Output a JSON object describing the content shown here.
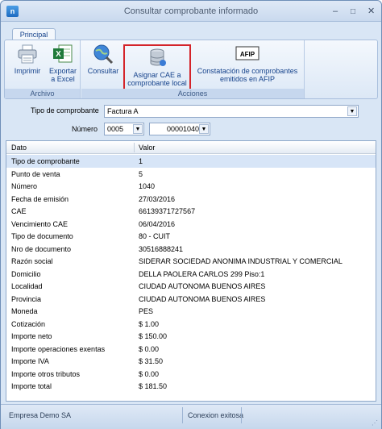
{
  "window": {
    "title": "Consultar comprobante informado",
    "app_icon": "n",
    "min_glyph": "–",
    "max_glyph": "□",
    "close_glyph": "✕"
  },
  "ribbon": {
    "tab_label": "Principal",
    "groups": {
      "archivo": "Archivo",
      "acciones": "Acciones"
    },
    "buttons": {
      "imprimir": "Imprimir",
      "exportar": "Exportar\na Excel",
      "consultar": "Consultar",
      "asignar": "Asignar CAE a\ncomprobante local",
      "constatacion": "Constatación de comprobantes\nemitidos en AFIP"
    },
    "afip_logo_text": "AFIP",
    "highlight_color": "#d4242a"
  },
  "form": {
    "tipo_label": "Tipo de comprobante",
    "tipo_value": "Factura A",
    "numero_label": "Número",
    "punto_venta_value": "0005",
    "numero_value": "00001040",
    "dropdown_glyph": "▼"
  },
  "grid": {
    "col_dato": "Dato",
    "col_valor": "Valor",
    "rows": [
      {
        "dato": "Tipo de comprobante",
        "valor": "1"
      },
      {
        "dato": "Punto de venta",
        "valor": "5"
      },
      {
        "dato": "Número",
        "valor": "1040"
      },
      {
        "dato": "Fecha de emisión",
        "valor": "27/03/2016"
      },
      {
        "dato": "CAE",
        "valor": "66139371727567"
      },
      {
        "dato": "Vencimiento CAE",
        "valor": "06/04/2016"
      },
      {
        "dato": "Tipo de documento",
        "valor": "80 - CUIT"
      },
      {
        "dato": "Nro de documento",
        "valor": "30516888241"
      },
      {
        "dato": "Razón social",
        "valor": "SIDERAR SOCIEDAD ANONIMA INDUSTRIAL Y COMERCIAL"
      },
      {
        "dato": "Domicilio",
        "valor": "DELLA PAOLERA CARLOS 299 Piso:1"
      },
      {
        "dato": "Localidad",
        "valor": "CIUDAD AUTONOMA BUENOS AIRES"
      },
      {
        "dato": "Provincia",
        "valor": "CIUDAD AUTONOMA BUENOS AIRES"
      },
      {
        "dato": "Moneda",
        "valor": "PES"
      },
      {
        "dato": "Cotización",
        "valor": "$ 1.00"
      },
      {
        "dato": "Importe neto",
        "valor": "$ 150.00"
      },
      {
        "dato": "Importe operaciones exentas",
        "valor": "$ 0.00"
      },
      {
        "dato": "Importe IVA",
        "valor": "$ 31.50"
      },
      {
        "dato": "Importe otros tributos",
        "valor": "$ 0.00"
      },
      {
        "dato": "Importe total",
        "valor": "$ 181.50"
      }
    ]
  },
  "status": {
    "empresa": "Empresa Demo SA",
    "conexion": "Conexion exitosa"
  }
}
